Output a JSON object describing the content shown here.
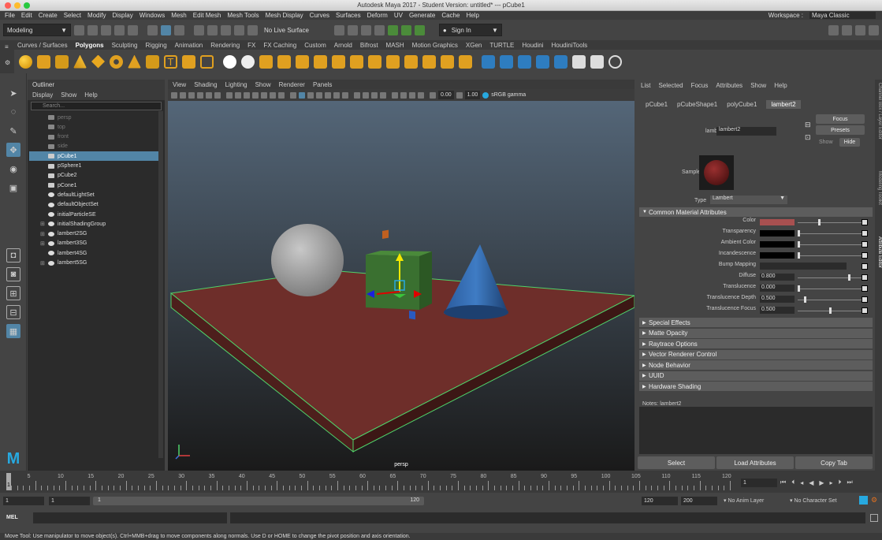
{
  "titlebar": {
    "title": "Autodesk Maya 2017 - Student Version: untitled*  ---  pCube1"
  },
  "menubar": {
    "items": [
      "File",
      "Edit",
      "Create",
      "Select",
      "Modify",
      "Display",
      "Windows",
      "Mesh",
      "Edit Mesh",
      "Mesh Tools",
      "Mesh Display",
      "Curves",
      "Surfaces",
      "Deform",
      "UV",
      "Generate",
      "Cache",
      "Help"
    ],
    "workspace_label": "Workspace :",
    "workspace_value": "Maya Classic"
  },
  "statusline": {
    "mode": "Modeling",
    "live_surface": "No Live Surface",
    "signin": "Sign In"
  },
  "shelf": {
    "tabs": [
      "Curves / Surfaces",
      "Polygons",
      "Sculpting",
      "Rigging",
      "Animation",
      "Rendering",
      "FX",
      "FX Caching",
      "Custom",
      "Arnold",
      "Bifrost",
      "MASH",
      "Motion Graphics",
      "XGen",
      "TURTLE",
      "Houdini",
      "HoudiniTools"
    ],
    "active": "Polygons"
  },
  "outliner": {
    "title": "Outliner",
    "menu": [
      "Display",
      "Show",
      "Help"
    ],
    "search_placeholder": "Search...",
    "items": [
      {
        "label": "persp",
        "kind": "camera",
        "dim": true
      },
      {
        "label": "top",
        "kind": "camera",
        "dim": true
      },
      {
        "label": "front",
        "kind": "camera",
        "dim": true
      },
      {
        "label": "side",
        "kind": "camera",
        "dim": true
      },
      {
        "label": "pCube1",
        "kind": "mesh",
        "selected": true
      },
      {
        "label": "pSphere1",
        "kind": "mesh"
      },
      {
        "label": "pCube2",
        "kind": "mesh"
      },
      {
        "label": "pCone1",
        "kind": "mesh"
      },
      {
        "label": "defaultLightSet",
        "kind": "set"
      },
      {
        "label": "defaultObjectSet",
        "kind": "set"
      },
      {
        "label": "initialParticleSE",
        "kind": "shading"
      },
      {
        "label": "initialShadingGroup",
        "kind": "shading",
        "expand": true
      },
      {
        "label": "lambert2SG",
        "kind": "shading",
        "expand": true
      },
      {
        "label": "lambert3SG",
        "kind": "shading",
        "expand": true
      },
      {
        "label": "lambert4SG",
        "kind": "shading"
      },
      {
        "label": "lambert5SG",
        "kind": "shading",
        "expand": true
      }
    ]
  },
  "viewport": {
    "menu": [
      "View",
      "Shading",
      "Lighting",
      "Show",
      "Renderer",
      "Panels"
    ],
    "value1": "0.00",
    "value2": "1.00",
    "colorspace": "sRGB gamma",
    "camera_label": "persp"
  },
  "attr": {
    "menu": [
      "List",
      "Selected",
      "Focus",
      "Attributes",
      "Show",
      "Help"
    ],
    "tabs": [
      "pCube1",
      "pCubeShape1",
      "polyCube1",
      "lambert2"
    ],
    "active_tab": "lambert2",
    "node_label": "lambert:",
    "node_value": "lambert2",
    "focus": "Focus",
    "presets": "Presets",
    "show": "Show",
    "hide": "Hide",
    "sample": "Sample",
    "type_label": "Type",
    "type_value": "Lambert",
    "common_section": "Common Material Attributes",
    "attributes": [
      {
        "label": "Color",
        "swatch": "#a85050",
        "knob": 0.33
      },
      {
        "label": "Transparency",
        "swatch": "#000000",
        "knob": 0.0
      },
      {
        "label": "Ambient Color",
        "swatch": "#000000",
        "knob": 0.0
      },
      {
        "label": "Incandescence",
        "swatch": "#000000",
        "knob": 0.0
      },
      {
        "label": "Bump Mapping"
      },
      {
        "label": "Diffuse",
        "value": "0.800",
        "knob": 0.8
      },
      {
        "label": "Translucence",
        "value": "0.000",
        "knob": 0.0
      },
      {
        "label": "Translucence Depth",
        "value": "0.500",
        "knob": 0.1
      },
      {
        "label": "Translucence Focus",
        "value": "0.500",
        "knob": 0.5
      }
    ],
    "sections": [
      "Special Effects",
      "Matte Opacity",
      "Raytrace Options",
      "Vector Renderer Control",
      "Node Behavior",
      "UUID",
      "Hardware Shading"
    ],
    "notes_label": "Notes:",
    "notes_value": "lambert2",
    "buttons": [
      "Select",
      "Load Attributes",
      "Copy Tab"
    ],
    "right_strip": [
      "Channel Box / Layer Editor",
      "Modeling Toolkit",
      "Attribute Editor"
    ]
  },
  "timeline": {
    "ticks": [
      "5",
      "10",
      "15",
      "20",
      "25",
      "30",
      "35",
      "40",
      "45",
      "50",
      "55",
      "60",
      "65",
      "70",
      "75",
      "80",
      "85",
      "90",
      "95",
      "100",
      "105",
      "110",
      "115",
      "120"
    ],
    "start_marker": "1",
    "current_frame": "1"
  },
  "range": {
    "start": "1",
    "anim_start": "1",
    "slider_label": "1",
    "slider_end": "120",
    "end": "120",
    "anim_end": "200",
    "anim_layer": "No Anim Layer",
    "char_set": "No Character Set"
  },
  "mel": {
    "label": "MEL"
  },
  "help": {
    "text": "Move Tool: Use manipulator to move object(s). Ctrl+MMB+drag to move components along normals. Use D or HOME to change the pivot position and axis orientation."
  },
  "colors": {
    "selection": "#5285a6",
    "floor": "#6e2e2a",
    "cube": "#3a7030",
    "cone": "#2e5c9c",
    "sphere": "#a0a0a0"
  }
}
